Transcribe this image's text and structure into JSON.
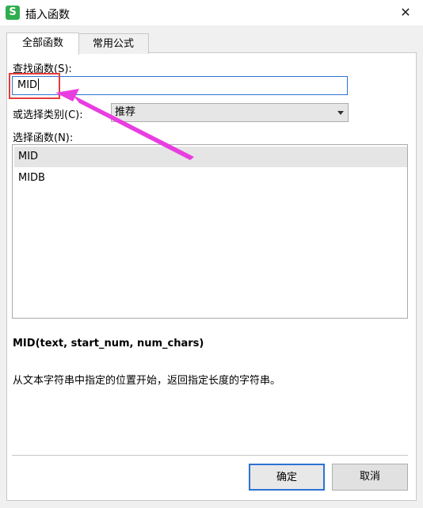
{
  "window": {
    "title": "插入函数",
    "app_icon_letter": "S",
    "close_glyph": "✕"
  },
  "tabs": [
    {
      "label": "全部函数"
    },
    {
      "label": "常用公式"
    }
  ],
  "search": {
    "label": "查找函数(S):",
    "value": "MID"
  },
  "category": {
    "label": "或选择类别(C):",
    "value": "推荐"
  },
  "function_list": {
    "label": "选择函数(N):",
    "items": [
      "MID",
      "MIDB"
    ],
    "selected_index": 0
  },
  "details": {
    "signature": "MID(text, start_num, num_chars)",
    "description": "从文本字符串中指定的位置开始，返回指定长度的字符串。"
  },
  "buttons": {
    "ok": "确定",
    "cancel": "取消"
  },
  "colors": {
    "annotation_box": "#e53b3b",
    "annotation_arrow": "#e83ee0",
    "focus": "#2c73d2"
  }
}
